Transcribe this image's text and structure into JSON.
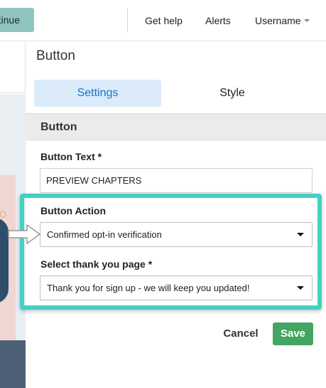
{
  "header": {
    "continue_label": "tinue",
    "nav": {
      "help": "Get help",
      "alerts": "Alerts",
      "username": "Username"
    }
  },
  "panel": {
    "title": "Button",
    "tabs": [
      {
        "label": "Settings",
        "active": true
      },
      {
        "label": "Style",
        "active": false
      }
    ],
    "section_title": "Button"
  },
  "form": {
    "button_text": {
      "label": "Button Text *",
      "value": "PREVIEW CHAPTERS"
    },
    "button_action": {
      "label": "Button Action",
      "selected": "Confirmed opt-in verification"
    },
    "thank_you_page": {
      "label": "Select thank you page *",
      "selected": "Thank you for sign up - we will keep you updated!"
    }
  },
  "actions": {
    "cancel": "Cancel",
    "save": "Save"
  },
  "colors": {
    "accent_tab": "#1a73c8",
    "highlight": "#43d1c4",
    "save": "#44a562",
    "continue": "#8fc4c1"
  }
}
